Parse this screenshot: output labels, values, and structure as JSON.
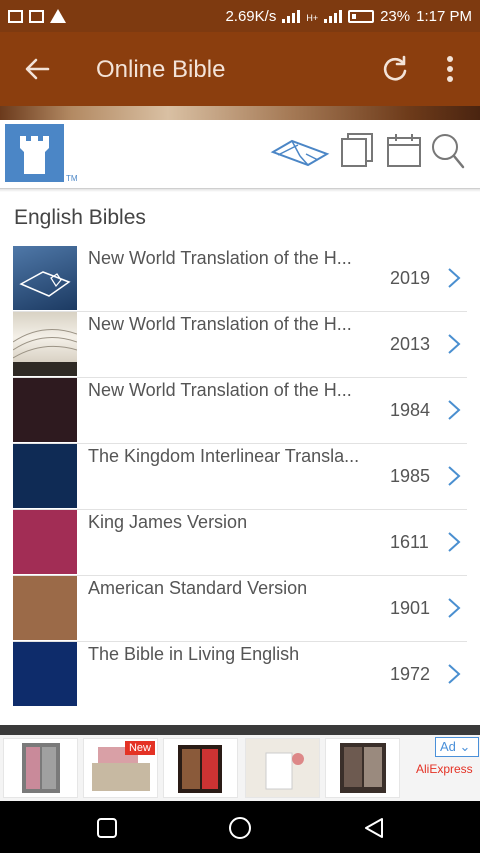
{
  "status_bar": {
    "speed": "2.69K/s",
    "signal_1_label": "H",
    "signal_2_label": "H+",
    "battery": "23%",
    "time": "1:17 PM"
  },
  "app_bar": {
    "title": "Online Bible"
  },
  "section": {
    "title": "English Bibles"
  },
  "bibles": [
    {
      "name": "New World Translation of the H...",
      "year": "2019",
      "color": "#2c4f7a"
    },
    {
      "name": "New World Translation of the H...",
      "year": "2013",
      "color": "#e8e2d6"
    },
    {
      "name": "New World Translation of the H...",
      "year": "1984",
      "color": "#2e1a1f"
    },
    {
      "name": "The Kingdom Interlinear Transla...",
      "year": "1985",
      "color": "#0f2b55"
    },
    {
      "name": "King James Version",
      "year": "1611",
      "color": "#a22d55"
    },
    {
      "name": "American Standard Version",
      "year": "1901",
      "color": "#9b6a48"
    },
    {
      "name": "The Bible in Living English",
      "year": "1972",
      "color": "#0e2c6b"
    }
  ],
  "ad": {
    "badge": "Ad",
    "brand": "AliExpress",
    "new_tag": "New"
  },
  "colors": {
    "status_bar": "#7e3a10",
    "app_bar": "#8b3e0e",
    "logo_blue": "#4b86c6",
    "chevron": "#4a8fd0"
  }
}
